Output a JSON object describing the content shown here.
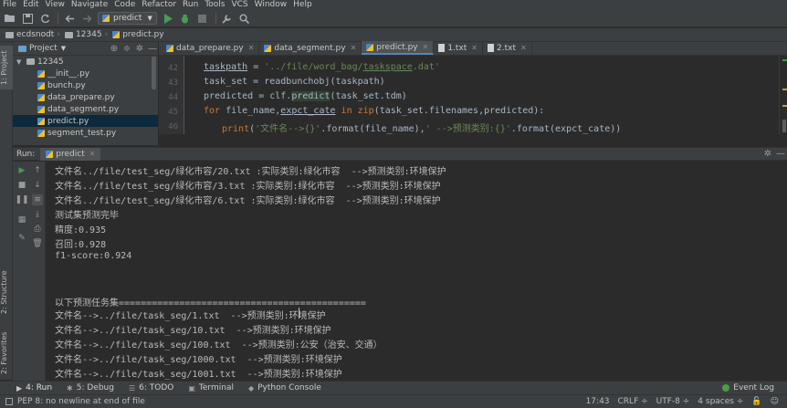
{
  "menu": [
    "File",
    "Edit",
    "View",
    "Navigate",
    "Code",
    "Refactor",
    "Run",
    "Tools",
    "VCS",
    "Window",
    "Help"
  ],
  "toolbar": {
    "run_config": "predict",
    "icons": [
      "open-folder-icon",
      "save-icon",
      "sync-icon",
      "back-icon",
      "forward-icon",
      "run-icon",
      "debug-icon",
      "stop-icon",
      "wrench-icon",
      "search-icon"
    ]
  },
  "breadcrumb": [
    "ecdsnodt",
    "12345",
    "predict.py"
  ],
  "left_strip": {
    "project": "1: Project",
    "structure": "2: Structure",
    "favorites": "2: Favorites"
  },
  "project": {
    "title": "Project",
    "tree": [
      {
        "label": "12345",
        "type": "folder"
      },
      {
        "label": "__init__.py",
        "type": "py"
      },
      {
        "label": "bunch.py",
        "type": "py"
      },
      {
        "label": "data_prepare.py",
        "type": "py"
      },
      {
        "label": "data_segment.py",
        "type": "py"
      },
      {
        "label": "predict.py",
        "type": "py",
        "selected": true
      },
      {
        "label": "segment_test.py",
        "type": "py"
      }
    ]
  },
  "editor": {
    "tabs": [
      {
        "label": "data_prepare.py",
        "type": "py"
      },
      {
        "label": "data_segment.py",
        "type": "py"
      },
      {
        "label": "predict.py",
        "type": "py",
        "active": true
      },
      {
        "label": "1.txt",
        "type": "txt"
      },
      {
        "label": "2.txt",
        "type": "txt"
      }
    ],
    "line_numbers": [
      "42",
      "43",
      "44",
      "45",
      "46"
    ]
  },
  "run": {
    "label": "Run:",
    "tab": "predict",
    "output": [
      "文件名../file/test_seg/绿化市容/20.txt :实际类别:绿化市容  -->预测类别:环境保护",
      "文件名../file/test_seg/绿化市容/3.txt :实际类别:绿化市容  -->预测类别:环境保护",
      "文件名../file/test_seg/绿化市容/6.txt :实际类别:绿化市容  -->预测类别:环境保护",
      "测试集预测完毕",
      "精度:0.935",
      "召回:0.928",
      "f1-score:0.924",
      "",
      "",
      "以下预测任务集=============================================",
      "文件名-->../file/task_seg/1.txt  -->预测类别:环境保护",
      "文件名-->../file/task_seg/10.txt  -->预测类别:环境保护",
      "文件名-->../file/task_seg/100.txt  -->预测类别:公安（治安、交通）",
      "文件名-->../file/task_seg/1000.txt  -->预测类别:环境保护",
      "文件名-->../file/task_seg/1001.txt  -->预测类别:环境保护"
    ]
  },
  "bottom_tabs": [
    {
      "label": "4: Run",
      "icon": "play-icon",
      "active": true
    },
    {
      "label": "5: Debug",
      "icon": "bug-icon"
    },
    {
      "label": "6: TODO",
      "icon": "todo-icon"
    },
    {
      "label": "Terminal",
      "icon": "terminal-icon"
    },
    {
      "label": "Python Console",
      "icon": "python-console-icon"
    }
  ],
  "event_log": "Event Log",
  "status": {
    "message": "PEP 8: no newline at end of file",
    "position": "17:43",
    "line_sep": "CRLF ÷",
    "encoding": "UTF-8 ÷",
    "indent": "4 spaces ÷"
  }
}
